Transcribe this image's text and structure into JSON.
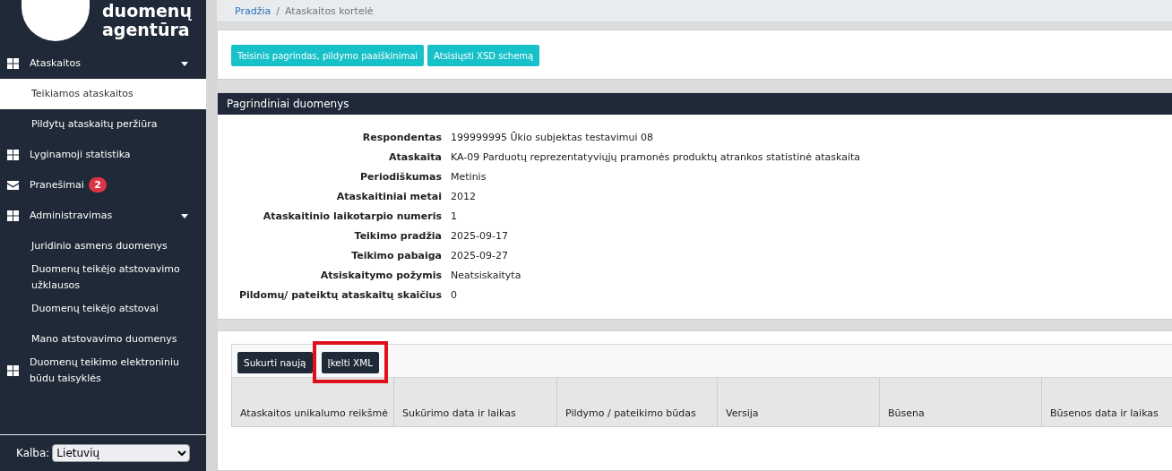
{
  "sidebar": {
    "logo": [
      "duomenų",
      "agentūra"
    ],
    "items": [
      {
        "label": "Ataskaitos",
        "kind": "grid",
        "expanded": true,
        "selected": false,
        "children": [
          {
            "label": "Teikiamos ataskaitos",
            "selected": true
          },
          {
            "label": "Pildytų ataskaitų peržiūra",
            "selected": false
          }
        ]
      },
      {
        "label": "Lyginamoji statistika",
        "kind": "grid",
        "selected": false
      },
      {
        "label": "Pranešimai",
        "kind": "mail",
        "selected": false,
        "badge": "2"
      },
      {
        "label": "Administravimas",
        "kind": "grid",
        "expanded": true,
        "selected": false,
        "children": [
          {
            "label": "Juridinio asmens duomenys",
            "selected": false
          },
          {
            "label": "Duomenų teikėjo atstovavimo užklausos",
            "selected": false
          },
          {
            "label": "Duomenų teikėjo atstovai",
            "selected": false
          },
          {
            "label": "Mano atstovavimo duomenys",
            "selected": false
          }
        ]
      },
      {
        "label": "Duomenų teikimo elektroniniu būdu taisyklės",
        "kind": "grid",
        "selected": false
      }
    ],
    "language": {
      "label": "Kalba:",
      "value": "Lietuvių"
    }
  },
  "breadcrumb": {
    "separator": "/",
    "items": [
      {
        "label": "Pradžia",
        "link": true
      },
      {
        "label": "Ataskaitos kortelė",
        "link": false
      }
    ]
  },
  "actions": [
    "Teisinis pagrindas, pildymo paaiškinimai",
    "Atsisiųsti XSD schemą"
  ],
  "details": {
    "title": "Pagrindiniai duomenys",
    "fields": [
      {
        "label": "Respondentas",
        "value": "199999995 Ūkio subjektas testavimui 08"
      },
      {
        "label": "Ataskaita",
        "value": "KA-09 Parduotų reprezentatyviųjų pramonės produktų atrankos statistinė ataskaita"
      },
      {
        "label": "Periodiškumas",
        "value": "Metinis"
      },
      {
        "label": "Ataskaitiniai metai",
        "value": "2012"
      },
      {
        "label": "Ataskaitinio laikotarpio numeris",
        "value": "1"
      },
      {
        "label": "Teikimo pradžia",
        "value": "2025-09-17"
      },
      {
        "label": "Teikimo pabaiga",
        "value": "2025-09-27"
      },
      {
        "label": "Atsiskaitymo požymis",
        "value": "Neatsiskaityta"
      },
      {
        "label": "Pildomų/ pateiktų ataskaitų skaičius",
        "value": "0"
      }
    ]
  },
  "submissions": {
    "buttons": [
      {
        "label": "Sukurti naują",
        "highlighted": false
      },
      {
        "label": "Įkelti XML",
        "highlighted": true
      }
    ],
    "columns": [
      "Ataskaitos unikalumo reikšmė",
      "Sukūrimo data ir laikas",
      "Pildymo / pateikimo būdas",
      "Versija",
      "Būsena",
      "Būsenos data ir laikas"
    ]
  }
}
